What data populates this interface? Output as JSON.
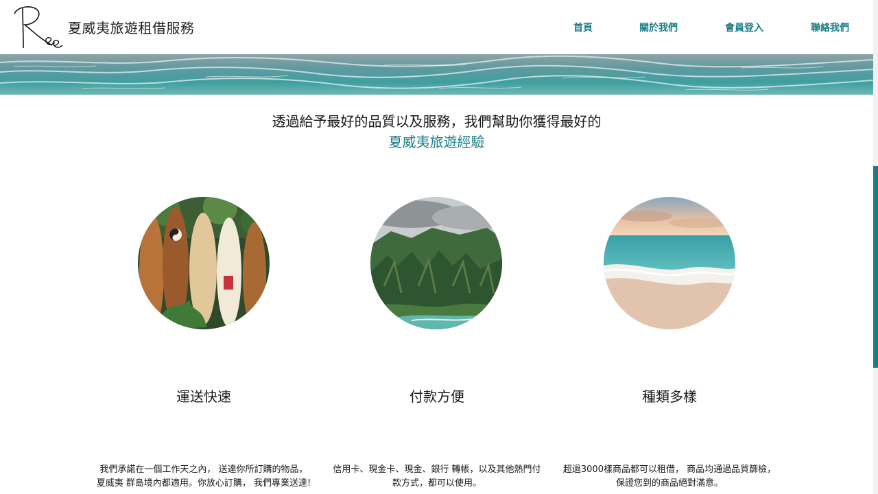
{
  "header": {
    "logo_text": "Ree",
    "site_title": "夏威夷旅遊租借服務",
    "nav": {
      "home": "首頁",
      "about": "關於我們",
      "login": "會員登入",
      "contact": "聯絡我們"
    }
  },
  "headline": {
    "line1": "透過給予最好的品質以及服務，我們幫助你獲得最好的",
    "line2": "夏威夷旅遊經驗"
  },
  "features": [
    {
      "image": "surfboards-photo",
      "title": "運送快速",
      "desc_line1": "我們承諾在一個工作天之內， 送達你所訂購的物品，",
      "desc_line2": "夏威夷 群島境內都適用。你放心訂購， 我們專業送達!"
    },
    {
      "image": "mountain-coast-photo",
      "title": "付款方便",
      "desc_line1": "信用卡、現金卡、現金、銀行 轉帳，以及其他熱門付",
      "desc_line2": "款方式，都可以使用。"
    },
    {
      "image": "beach-sunset-photo",
      "title": "種類多樣",
      "desc_line1": "超過3000樣商品都可以租借， 商品均通過品質篩檢，",
      "desc_line2": "保證您到的商品絕對滿意。"
    }
  ],
  "colors": {
    "accent": "#1a7d86",
    "text": "#1a1a1a",
    "scrollbar_thumb": "#1a7d86"
  }
}
